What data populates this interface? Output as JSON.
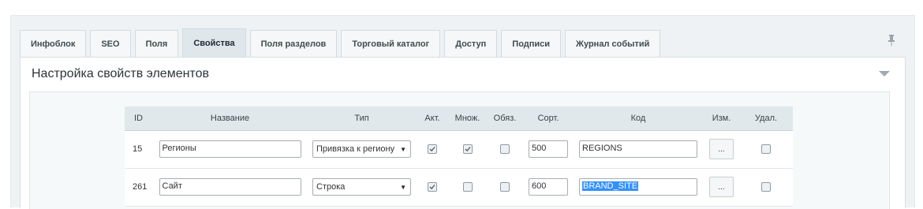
{
  "tabs": [
    {
      "label": "Инфоблок",
      "active": false
    },
    {
      "label": "SEO",
      "active": false
    },
    {
      "label": "Поля",
      "active": false
    },
    {
      "label": "Свойства",
      "active": true
    },
    {
      "label": "Поля разделов",
      "active": false
    },
    {
      "label": "Торговый каталог",
      "active": false
    },
    {
      "label": "Доступ",
      "active": false
    },
    {
      "label": "Подписи",
      "active": false
    },
    {
      "label": "Журнал событий",
      "active": false
    }
  ],
  "panel": {
    "title": "Настройка свойств элементов"
  },
  "table": {
    "headers": {
      "id": "ID",
      "name": "Название",
      "type": "Тип",
      "active": "Акт.",
      "multiple": "Множ.",
      "required": "Обяз.",
      "sort": "Сорт.",
      "code": "Код",
      "edit": "Изм.",
      "delete": "Удал."
    },
    "rows": [
      {
        "id": "15",
        "name": "Регионы",
        "type": "Привязка к региону",
        "active": true,
        "multiple": true,
        "required": false,
        "sort": "500",
        "code": "REGIONS",
        "code_selected": false,
        "edit_label": "...",
        "delete": false
      },
      {
        "id": "261",
        "name": "Сайт",
        "type": "Строка",
        "active": true,
        "multiple": false,
        "required": false,
        "sort": "600",
        "code": "BRAND_SITE",
        "code_selected": true,
        "edit_label": "...",
        "delete": false
      }
    ]
  },
  "icons": {
    "pin": "pin-icon",
    "collapse": "collapse-arrow-icon",
    "check": "check-icon",
    "dropdown": "dropdown-caret-icon"
  },
  "colors": {
    "active_tab": "#dfe7eb",
    "header_bg": "#e0e8eb",
    "selection": "#3390ff"
  }
}
